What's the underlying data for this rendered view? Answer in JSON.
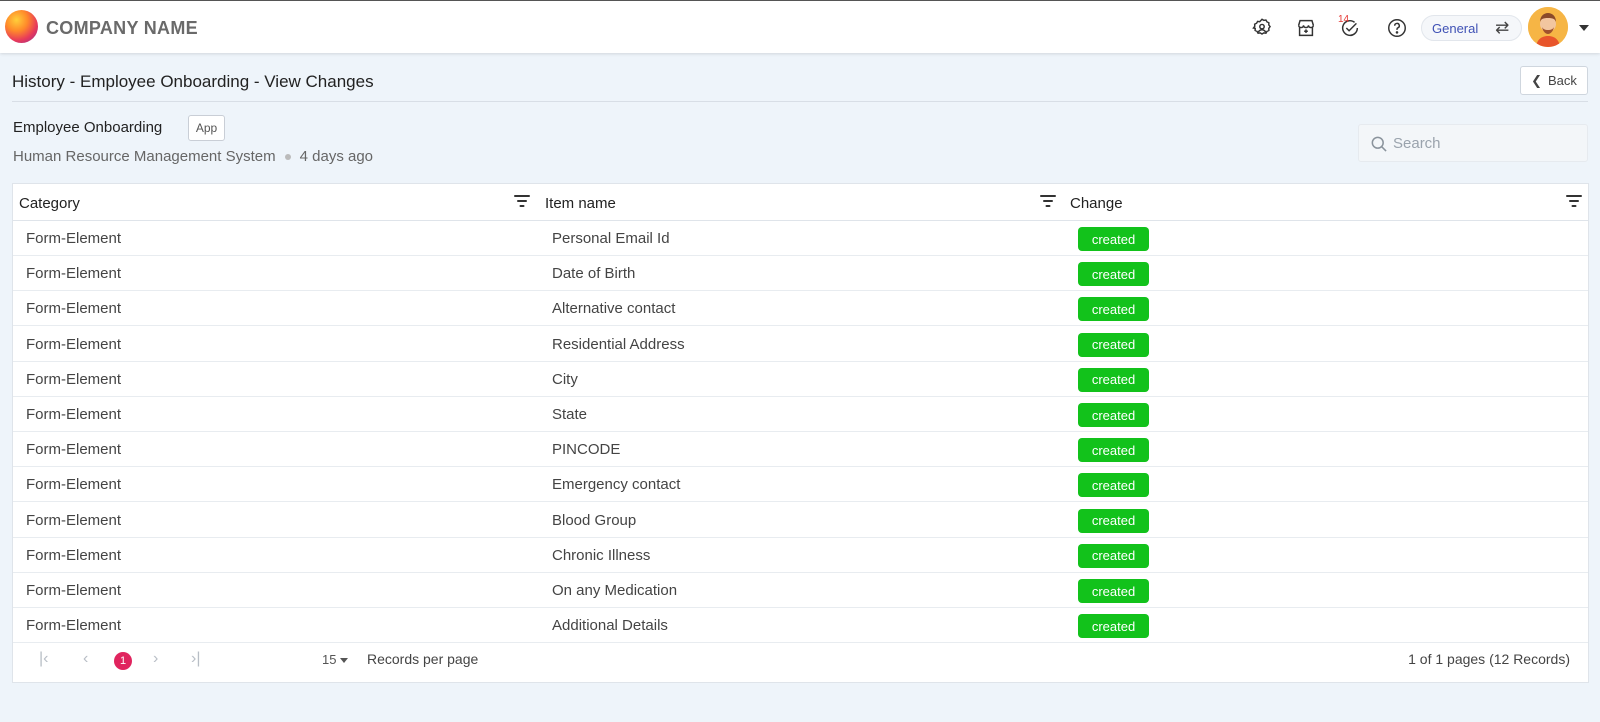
{
  "header": {
    "company_name": "COMPANY NAME",
    "notification_count": "14",
    "workspace_label": "General",
    "icons": [
      "settings-icon",
      "store-icon",
      "tasks-icon",
      "help-icon",
      "swap-icon",
      "avatar",
      "chevron-down-icon"
    ]
  },
  "page": {
    "title": "History - Employee Onboarding - View Changes",
    "back_label": "Back",
    "app_name": "Employee Onboarding",
    "app_tag": "App",
    "system_name": "Human Resource Management System",
    "time_ago": "4 days ago",
    "search_placeholder": "Search"
  },
  "table": {
    "columns": [
      "Category",
      "Item name",
      "Change"
    ],
    "rows": [
      {
        "category": "Form-Element",
        "item": "Personal Email Id",
        "change": "created"
      },
      {
        "category": "Form-Element",
        "item": "Date of Birth",
        "change": "created"
      },
      {
        "category": "Form-Element",
        "item": "Alternative contact",
        "change": "created"
      },
      {
        "category": "Form-Element",
        "item": "Residential Address",
        "change": "created"
      },
      {
        "category": "Form-Element",
        "item": "City",
        "change": "created"
      },
      {
        "category": "Form-Element",
        "item": "State",
        "change": "created"
      },
      {
        "category": "Form-Element",
        "item": "PINCODE",
        "change": "created"
      },
      {
        "category": "Form-Element",
        "item": "Emergency contact",
        "change": "created"
      },
      {
        "category": "Form-Element",
        "item": "Blood Group",
        "change": "created"
      },
      {
        "category": "Form-Element",
        "item": "Chronic Illness",
        "change": "created"
      },
      {
        "category": "Form-Element",
        "item": "On any Medication",
        "change": "created"
      },
      {
        "category": "Form-Element",
        "item": "Additional Details",
        "change": "created"
      }
    ]
  },
  "pagination": {
    "current_page": "1",
    "per_page": "15",
    "per_page_label": "Records per page",
    "summary": "1 of 1 pages (12 Records)"
  },
  "colors": {
    "accent": "#3f51b5",
    "created_chip": "#12c21b",
    "active_page": "#e0245e",
    "background": "#eef4fa"
  }
}
